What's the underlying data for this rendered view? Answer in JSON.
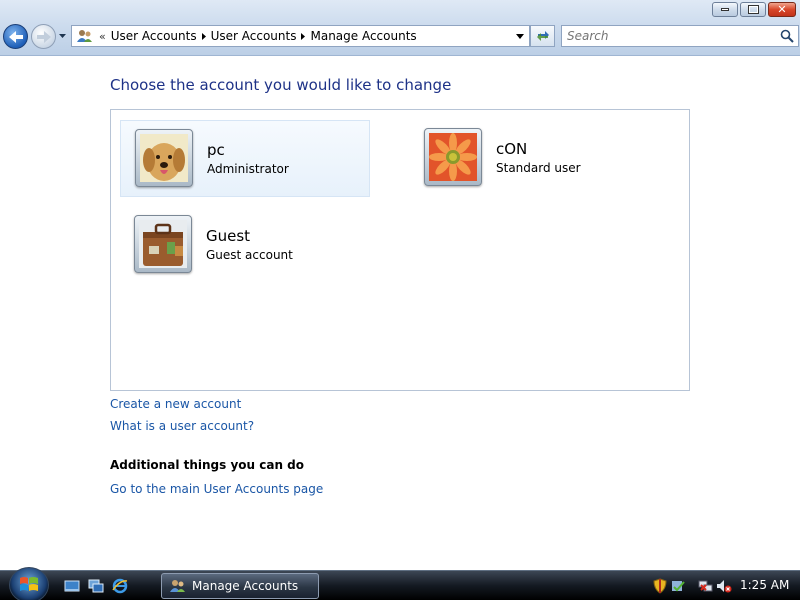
{
  "nav": {
    "breadcrumb": [
      "User Accounts",
      "User Accounts",
      "Manage Accounts"
    ],
    "overflow_chevron": "«",
    "search_placeholder": "Search"
  },
  "window_buttons": [
    "minimize",
    "restore",
    "close"
  ],
  "content": {
    "heading": "Choose the account you would like to change",
    "accounts": [
      {
        "name": "pc",
        "type": "Administrator",
        "picture": "dog-picture",
        "selected": true
      },
      {
        "name": "cON",
        "type": "Standard user",
        "picture": "flower-picture",
        "selected": false
      },
      {
        "name": "Guest",
        "type": "Guest account",
        "picture": "suitcase-picture",
        "selected": false
      }
    ],
    "links": {
      "create": "Create a new account",
      "what_is": "What is a user account?"
    },
    "additional_heading": "Additional things you can do",
    "additional_links": [
      "Go to the main User Accounts page"
    ]
  },
  "taskbar": {
    "task_label": "Manage Accounts",
    "clock": "1:25 AM"
  },
  "colors": {
    "heading": "#1e3287",
    "link": "#1a56a6",
    "selection_bg": "#e7f1fb"
  }
}
